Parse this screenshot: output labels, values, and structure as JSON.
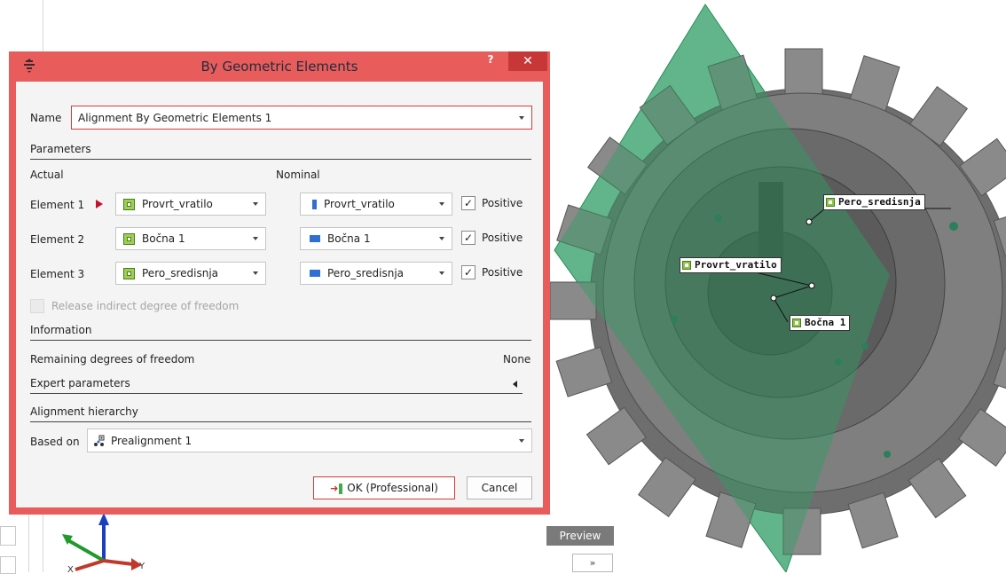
{
  "dialog": {
    "title": "By Geometric Elements",
    "help_label": "?",
    "close_label": "✕",
    "name_label": "Name",
    "name_value": "Alignment By Geometric Elements 1",
    "parameters_heading": "Parameters",
    "actual_heading": "Actual",
    "nominal_heading": "Nominal",
    "elements": [
      {
        "label": "Element 1",
        "actual": "Provrt_vratilo",
        "nominal": "Provrt_vratilo",
        "nominal_icon": "cylinder-icon",
        "positive_label": "Positive",
        "positive_checked": true
      },
      {
        "label": "Element 2",
        "actual": "Bočna 1",
        "nominal": "Bočna 1",
        "nominal_icon": "plane-icon",
        "positive_label": "Positive",
        "positive_checked": true
      },
      {
        "label": "Element 3",
        "actual": "Pero_sredisnja",
        "nominal": "Pero_sredisnja",
        "nominal_icon": "plane-icon",
        "positive_label": "Positive",
        "positive_checked": true
      }
    ],
    "release_label": "Release indirect degree of freedom",
    "information_heading": "Information",
    "remaining_label": "Remaining degrees of freedom",
    "remaining_value": "None",
    "expert_label": "Expert parameters",
    "hierarchy_heading": "Alignment hierarchy",
    "based_on_label": "Based on",
    "based_on_value": "Prealignment 1",
    "ok_label": "OK (Professional)",
    "cancel_label": "Cancel"
  },
  "scene": {
    "labels": {
      "pero": "Pero_sredisnja",
      "provrt": "Provrt_vratilo",
      "bocna": "Bočna 1"
    },
    "preview_label": "Preview",
    "collapse_label": "»",
    "axis_x": "X",
    "axis_y": "Y"
  },
  "colors": {
    "dialog_border": "#e85c5c",
    "close_button": "#c83737",
    "plane": "#2e9d64",
    "gear": "#7c7c7c"
  }
}
